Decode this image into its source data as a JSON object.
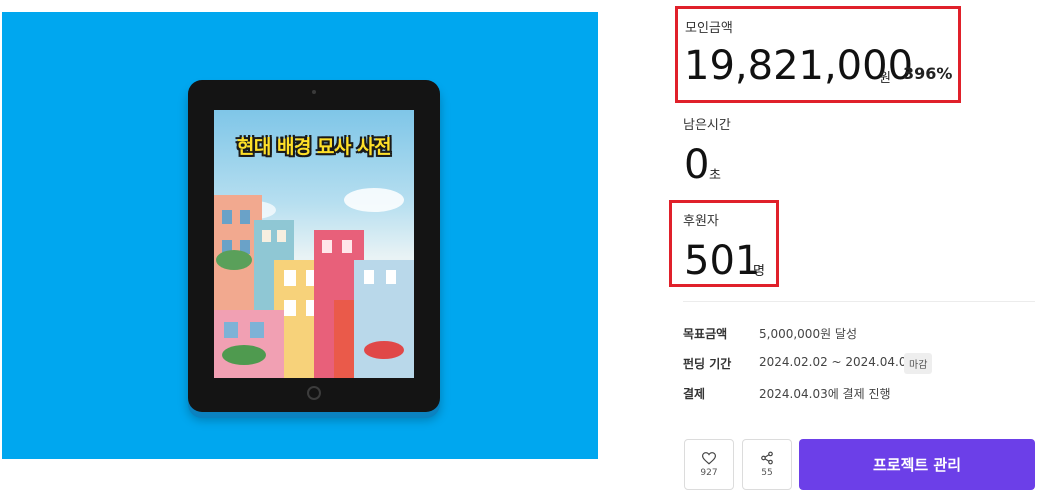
{
  "hero": {
    "cover_title": "현대 배경 묘사 사전"
  },
  "funding": {
    "label": "모인금액",
    "amount": "19,821,000",
    "unit": "원",
    "percent": "396%"
  },
  "time_left": {
    "label": "남은시간",
    "value": "0",
    "unit": "초"
  },
  "backers": {
    "label": "후원자",
    "value": "501",
    "unit": "명"
  },
  "details": {
    "goal_label": "목표금액",
    "goal_value": "5,000,000원 달성",
    "period_label": "펀딩 기간",
    "period_value": "2024.02.02 ~ 2024.04.02",
    "period_badge": "마감",
    "payment_label": "결제",
    "payment_value": "2024.04.03에 결제 진행"
  },
  "actions": {
    "like_count": "927",
    "share_count": "55",
    "manage_label": "프로젝트 관리"
  },
  "colors": {
    "hero_bg": "#00a7ef",
    "highlight": "#e0202a",
    "primary": "#6c3fe8"
  }
}
